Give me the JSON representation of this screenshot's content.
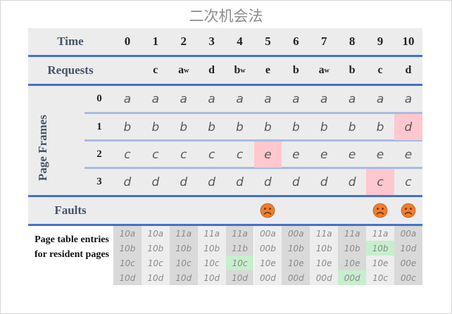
{
  "title": "二次机会法",
  "headers": {
    "time": "Time",
    "requests": "Requests",
    "page_frames": "Page Frames",
    "faults": "Faults",
    "page_table_entries": "Page table entries for resident pages"
  },
  "frame_labels": [
    "0",
    "1",
    "2",
    "3"
  ],
  "times": [
    "0",
    "1",
    "2",
    "3",
    "4",
    "5",
    "6",
    "7",
    "8",
    "9",
    "10"
  ],
  "requests": [
    {
      "p": "",
      "w": ""
    },
    {
      "p": "c",
      "w": ""
    },
    {
      "p": "a",
      "w": "w"
    },
    {
      "p": "d",
      "w": ""
    },
    {
      "p": "b",
      "w": "w"
    },
    {
      "p": "e",
      "w": ""
    },
    {
      "p": "b",
      "w": ""
    },
    {
      "p": "a",
      "w": "w"
    },
    {
      "p": "b",
      "w": ""
    },
    {
      "p": "c",
      "w": ""
    },
    {
      "p": "d",
      "w": ""
    }
  ],
  "frames": [
    [
      "a",
      "a",
      "a",
      "a",
      "a",
      "a",
      "a",
      "a",
      "a",
      "a",
      "a"
    ],
    [
      "b",
      "b",
      "b",
      "b",
      "b",
      "b",
      "b",
      "b",
      "b",
      "b",
      "d"
    ],
    [
      "c",
      "c",
      "c",
      "c",
      "c",
      "e",
      "e",
      "e",
      "e",
      "e",
      "e"
    ],
    [
      "d",
      "d",
      "d",
      "d",
      "d",
      "d",
      "d",
      "d",
      "d",
      "c",
      "c"
    ]
  ],
  "replaced_cells": [
    [
      1,
      10
    ],
    [
      2,
      5
    ],
    [
      3,
      9
    ]
  ],
  "faults": [
    5,
    9,
    10
  ],
  "page_table": [
    [
      "10a",
      "10b",
      "10c",
      "10d"
    ],
    [
      "10a",
      "10b",
      "10c",
      "10d"
    ],
    [
      "11a",
      "10b",
      "10c",
      "10d"
    ],
    [
      "11a",
      "10b",
      "10c",
      "10d"
    ],
    [
      "11a",
      "11b",
      "10c",
      "10d"
    ],
    [
      "00a",
      "00b",
      "10e",
      "00d"
    ],
    [
      "00a",
      "10b",
      "10e",
      "00d"
    ],
    [
      "11a",
      "10b",
      "10e",
      "00d"
    ],
    [
      "11a",
      "10b",
      "10e",
      "00d"
    ],
    [
      "11a",
      "10b",
      "10e",
      "10c"
    ],
    [
      "00a",
      "10d",
      "00e",
      "00c"
    ]
  ],
  "page_table_highlights": [
    [
      4,
      2
    ],
    [
      8,
      3
    ],
    [
      9,
      1
    ]
  ],
  "colors": {
    "accent_line": "#4472c4",
    "sub_line": "#a9bbe0",
    "band": "#ececec",
    "replaced": "#ffc7ce",
    "pt_highlight": "#c6efce",
    "pt_dark": "#d9d9d9",
    "pt_light": "#ededed",
    "fault_face": "#ed7d31"
  },
  "icons": {
    "fault": "frown-face-icon"
  }
}
